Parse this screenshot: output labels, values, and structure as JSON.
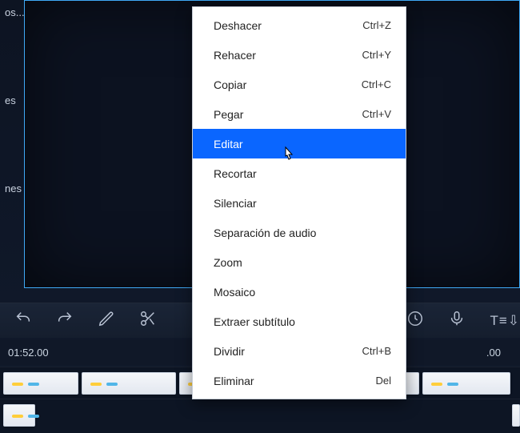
{
  "sidebar": {
    "label_fragment_1": "os...",
    "label_fragment_2": "es",
    "label_fragment_3": "nes"
  },
  "toolbar": {
    "icons": {
      "undo": "undo-icon",
      "redo": "redo-icon",
      "pencil": "pencil-icon",
      "scissors": "scissors-icon",
      "clock": "clock-icon",
      "mic": "mic-icon",
      "text_to_speech": "T≡⇩"
    }
  },
  "timebar": {
    "time_left": "01:52.00",
    "time_right": ".00"
  },
  "menu": {
    "items": [
      {
        "label": "Deshacer",
        "shortcut": "Ctrl+Z",
        "highlight": false
      },
      {
        "label": "Rehacer",
        "shortcut": "Ctrl+Y",
        "highlight": false
      },
      {
        "label": "Copiar",
        "shortcut": "Ctrl+C",
        "highlight": false
      },
      {
        "label": "Pegar",
        "shortcut": "Ctrl+V",
        "highlight": false
      },
      {
        "label": "Editar",
        "shortcut": "",
        "highlight": true
      },
      {
        "label": "Recortar",
        "shortcut": "",
        "highlight": false
      },
      {
        "label": "Silenciar",
        "shortcut": "",
        "highlight": false
      },
      {
        "label": "Separación de audio",
        "shortcut": "",
        "highlight": false
      },
      {
        "label": "Zoom",
        "shortcut": "",
        "highlight": false
      },
      {
        "label": "Mosaico",
        "shortcut": "",
        "highlight": false
      },
      {
        "label": "Extraer subtítulo",
        "shortcut": "",
        "highlight": false
      },
      {
        "label": "Dividir",
        "shortcut": "Ctrl+B",
        "highlight": false
      },
      {
        "label": "Eliminar",
        "shortcut": "Del",
        "highlight": false
      }
    ]
  }
}
